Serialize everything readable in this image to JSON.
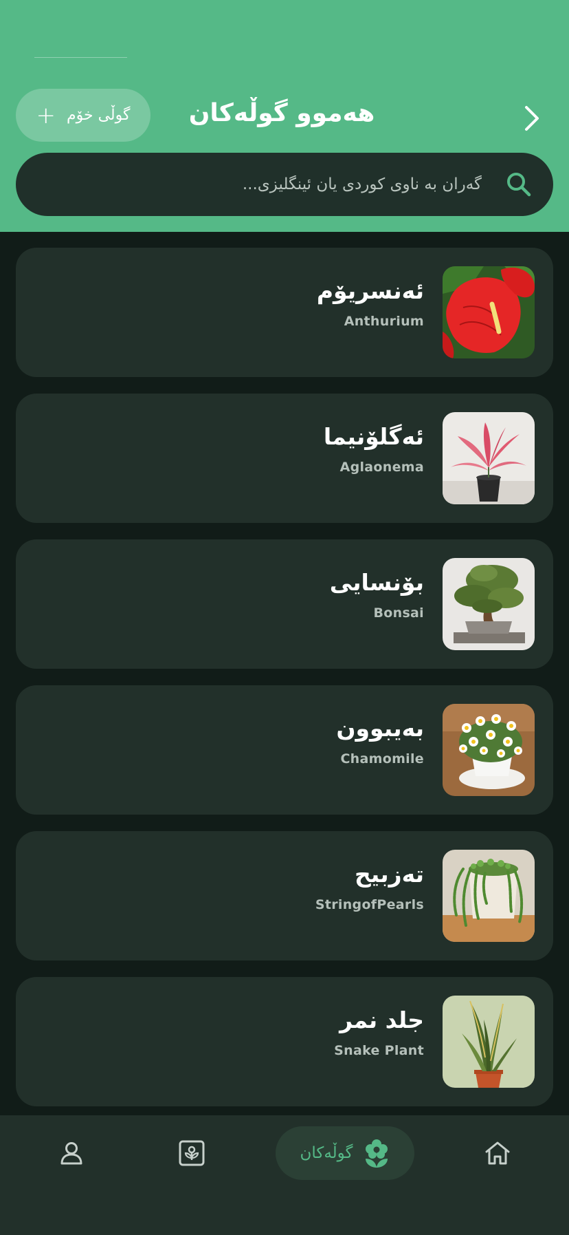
{
  "header": {
    "title": "هەموو گوڵەکان",
    "add_button_label": "گوڵی خۆم",
    "back_icon": "chevron-right-icon",
    "add_icon": "plus-icon",
    "background_color": "#55b987"
  },
  "search": {
    "placeholder": "گەران بە ناوی کوردی یان ئینگلیزی...",
    "value": "",
    "icon": "search-icon"
  },
  "plants": [
    {
      "name_ku": "ئەنسریۆم",
      "name_en": "Anthurium",
      "image": "anthurium-photo"
    },
    {
      "name_ku": "ئەگلۆنیما",
      "name_en": "Aglaonema",
      "image": "aglaonema-photo"
    },
    {
      "name_ku": "بۆنسایی",
      "name_en": "Bonsai",
      "image": "bonsai-photo"
    },
    {
      "name_ku": "بەیبوون",
      "name_en": "Chamomile",
      "image": "chamomile-photo"
    },
    {
      "name_ku": "تەزبیح",
      "name_en": "StringofPearls",
      "image": "string-of-pearls-photo"
    },
    {
      "name_ku": "جلد نمر",
      "name_en": "Snake Plant",
      "image": "snake-plant-photo"
    }
  ],
  "bottom_nav": {
    "items": [
      {
        "name": "profile",
        "icon": "user-icon"
      },
      {
        "name": "plant-care",
        "icon": "plant-box-icon"
      },
      {
        "name": "flowers",
        "icon": "flower-icon",
        "label": "گوڵەکان",
        "active": true
      },
      {
        "name": "home",
        "icon": "home-icon"
      }
    ],
    "active_color": "#55b987"
  }
}
